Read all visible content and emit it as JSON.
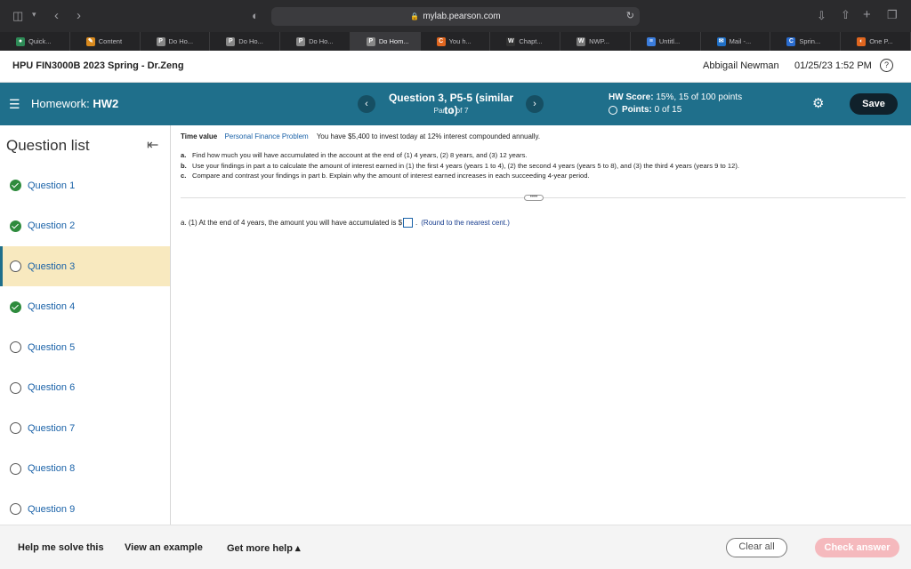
{
  "browser": {
    "url": "mylab.pearson.com",
    "tabs": [
      {
        "label": "Quick...",
        "color": "#2e8b57",
        "glyph": "●"
      },
      {
        "label": "Content",
        "color": "#d98a1e",
        "glyph": "✎"
      },
      {
        "label": "Do Ho...",
        "color": "#888",
        "glyph": "P"
      },
      {
        "label": "Do Ho...",
        "color": "#888",
        "glyph": "P"
      },
      {
        "label": "Do Ho...",
        "color": "#888",
        "glyph": "P"
      },
      {
        "label": "Do Hom...",
        "color": "#888",
        "glyph": "P"
      },
      {
        "label": "You h...",
        "color": "#e0661f",
        "glyph": "C"
      },
      {
        "label": "Chapt...",
        "color": "#333",
        "glyph": "W"
      },
      {
        "label": "NWP...",
        "color": "#777",
        "glyph": "W"
      },
      {
        "label": "Untitl...",
        "color": "#3b7ddd",
        "glyph": "≡"
      },
      {
        "label": "Mail -...",
        "color": "#1f6fc6",
        "glyph": "✉"
      },
      {
        "label": "Sprin...",
        "color": "#2a6ccf",
        "glyph": "C"
      },
      {
        "label": "One P...",
        "color": "#e0661f",
        "glyph": "◐"
      }
    ],
    "active_tab_index": 5
  },
  "course": {
    "title": "HPU FIN3000B 2023 Spring - Dr.Zeng",
    "user": "Abbigail Newman",
    "datetime": "01/25/23 1:52 PM",
    "help_glyph": "?"
  },
  "header": {
    "homework_label": "Homework:",
    "homework_name": "HW2",
    "question_title": "Question 3, P5-5 (similar to)",
    "part": "Part 1 of 7",
    "hw_score_label": "HW Score:",
    "hw_score_value": "15%, 15 of 100 points",
    "points_label": "Points:",
    "points_value": "0 of 15",
    "save_label": "Save"
  },
  "sidebar": {
    "title": "Question list",
    "items": [
      {
        "label": "Question 1",
        "status": "done"
      },
      {
        "label": "Question 2",
        "status": "done"
      },
      {
        "label": "Question 3",
        "status": "current"
      },
      {
        "label": "Question 4",
        "status": "done"
      },
      {
        "label": "Question 5",
        "status": "todo"
      },
      {
        "label": "Question 6",
        "status": "todo"
      },
      {
        "label": "Question 7",
        "status": "todo"
      },
      {
        "label": "Question 8",
        "status": "todo"
      },
      {
        "label": "Question 9",
        "status": "todo"
      }
    ]
  },
  "question": {
    "topic": "Time value",
    "category_link": "Personal Finance Problem",
    "prompt": "You have $5,400 to invest today at 12% interest compounded annually.",
    "parts": [
      {
        "letter": "a.",
        "text": "Find how much you will have accumulated in the account at the end of (1) 4 years, (2) 8 years, and (3) 12 years."
      },
      {
        "letter": "b.",
        "text": "Use your findings in part a to calculate the amount of interest earned in (1) the first 4 years (years 1 to 4), (2) the second 4 years (years 5 to 8), and (3) the third 4 years (years 9 to 12)."
      },
      {
        "letter": "c.",
        "text": "Compare and contrast your findings in part b. Explain why the amount of interest earned increases in each succeeding 4-year period."
      }
    ],
    "more_glyph": "••••",
    "answer_prefix": "a.  (1) At the end of 4 years, the amount you will have accumulated is $",
    "answer_value": "",
    "answer_suffix": ".",
    "answer_hint": "(Round to the nearest cent.)"
  },
  "footer": {
    "help_solve": "Help me solve this",
    "view_example": "View an example",
    "more_help": "Get more help ▴",
    "clear_all": "Clear all",
    "check_answer": "Check answer"
  }
}
